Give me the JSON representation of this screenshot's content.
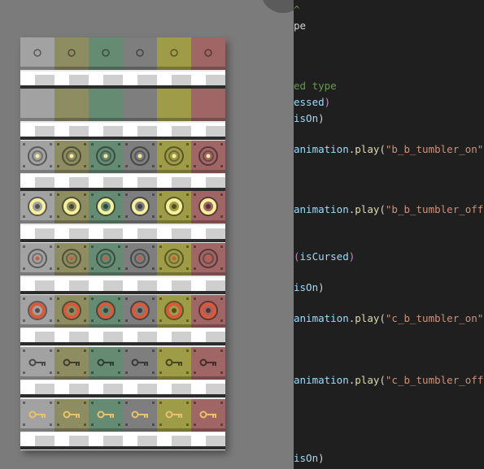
{
  "sprite_sheet": {
    "columns": 6,
    "tile_colors": [
      "#a2a2a2",
      "#8e8c61",
      "#668b73",
      "#7e7e7e",
      "#9e9c47",
      "#a06565"
    ],
    "rows": [
      {
        "kind": "tile",
        "icon": "small-ring-icon",
        "icon_color": "#6a6a6a"
      },
      {
        "kind": "strip"
      },
      {
        "kind": "tile",
        "icon": "none"
      },
      {
        "kind": "strip"
      },
      {
        "kind": "tile",
        "icon": "tumbler-on-icon",
        "icon_color": "#f4eca0"
      },
      {
        "kind": "tile",
        "icon": "tumbler-bright-icon",
        "icon_color": "#f6f09a"
      },
      {
        "kind": "strip"
      },
      {
        "kind": "tile",
        "icon": "tumbler-red-icon",
        "icon_color": "#cc5a3d"
      },
      {
        "kind": "strip"
      },
      {
        "kind": "tile",
        "icon": "tumbler-red-large-icon",
        "icon_color": "#d95a3a"
      },
      {
        "kind": "strip"
      },
      {
        "kind": "tile",
        "icon": "key-icon",
        "icon_color": "#5a5a5a"
      },
      {
        "kind": "strip"
      },
      {
        "kind": "tile",
        "icon": "golden-key-icon",
        "icon_color": "#e8c070"
      },
      {
        "kind": "strip"
      }
    ]
  },
  "code_editor": {
    "lines": [
      {
        "tokens": [
          {
            "text": "^",
            "cls": "t-com"
          }
        ]
      },
      {
        "tokens": [
          {
            "text": "pe",
            "cls": "t-plain"
          }
        ]
      },
      {
        "tokens": [
          {
            "text": "",
            "cls": "t-plain"
          }
        ]
      },
      {
        "tokens": [
          {
            "text": "",
            "cls": "t-plain"
          }
        ]
      },
      {
        "tokens": [
          {
            "text": "ed type",
            "cls": "t-com"
          }
        ]
      },
      {
        "tokens": [
          {
            "text": "essed",
            "cls": "t-var"
          },
          {
            "text": ")",
            "cls": "t-paren"
          }
        ]
      },
      {
        "tokens": [
          {
            "text": "isOn",
            "cls": "t-var"
          },
          {
            "text": ")",
            "cls": "t-plain"
          }
        ]
      },
      {
        "tokens": [
          {
            "text": "animation",
            "cls": "t-var"
          },
          {
            "text": ".",
            "cls": "t-plain"
          },
          {
            "text": "play",
            "cls": "t-fn"
          },
          {
            "text": "(",
            "cls": "t-plain"
          },
          {
            "text": "\"b_b_tumbler_on\"",
            "cls": "t-str"
          }
        ]
      },
      {
        "tokens": [
          {
            "text": "animation",
            "cls": "t-var"
          },
          {
            "text": ".",
            "cls": "t-plain"
          },
          {
            "text": "play",
            "cls": "t-fn"
          },
          {
            "text": "(",
            "cls": "t-plain"
          },
          {
            "text": "\"b_b_tumbler_off",
            "cls": "t-str"
          }
        ]
      },
      {
        "tokens": [
          {
            "text": "(",
            "cls": "t-paren"
          },
          {
            "text": "isCursed",
            "cls": "t-var"
          },
          {
            "text": ")",
            "cls": "t-paren"
          }
        ]
      },
      {
        "tokens": [
          {
            "text": "isOn",
            "cls": "t-var"
          },
          {
            "text": ")",
            "cls": "t-plain"
          }
        ]
      },
      {
        "tokens": [
          {
            "text": "animation",
            "cls": "t-var"
          },
          {
            "text": ".",
            "cls": "t-plain"
          },
          {
            "text": "play",
            "cls": "t-fn"
          },
          {
            "text": "(",
            "cls": "t-plain"
          },
          {
            "text": "\"c_b_tumbler_on\"",
            "cls": "t-str"
          }
        ]
      },
      {
        "tokens": [
          {
            "text": "animation",
            "cls": "t-var"
          },
          {
            "text": ".",
            "cls": "t-plain"
          },
          {
            "text": "play",
            "cls": "t-fn"
          },
          {
            "text": "(",
            "cls": "t-plain"
          },
          {
            "text": "\"c_b_tumbler_off",
            "cls": "t-str"
          }
        ]
      },
      {
        "tokens": [
          {
            "text": "isOn",
            "cls": "t-var"
          },
          {
            "text": ")",
            "cls": "t-plain"
          }
        ]
      }
    ]
  }
}
